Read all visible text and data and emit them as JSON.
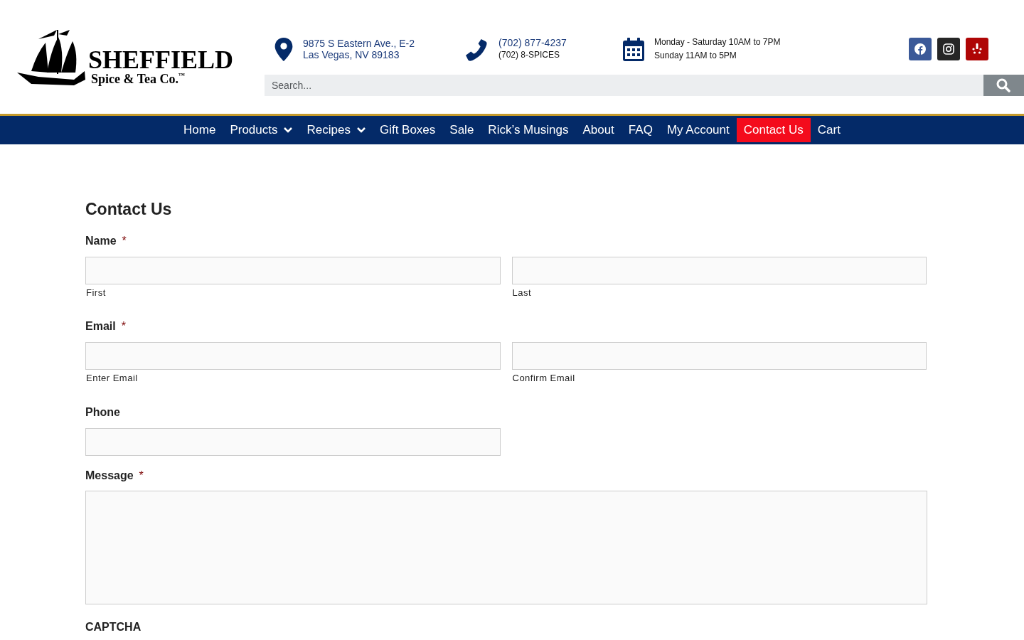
{
  "logo": {
    "name": "SHEFFIELD",
    "tagline": "Spice & Tea Co.",
    "mark": "™"
  },
  "contact": {
    "address": [
      "9875 S Eastern Ave., E-2",
      "Las Vegas, NV 89183"
    ],
    "phones": [
      "(702) 877-4237",
      "(702) 8-SPICES"
    ],
    "hours": [
      "Monday - Saturday 10AM to 7PM",
      "Sunday 11AM to 5PM"
    ]
  },
  "social": [
    {
      "kind": "facebook",
      "color": "#3b5998"
    },
    {
      "kind": "instagram",
      "color": "#262626"
    },
    {
      "kind": "yelp",
      "color": "#af0606"
    }
  ],
  "search": {
    "placeholder": "Search..."
  },
  "nav": [
    {
      "label": "Home",
      "dropdown": false,
      "selected": false
    },
    {
      "label": "Products",
      "dropdown": true,
      "selected": false
    },
    {
      "label": "Recipes",
      "dropdown": true,
      "selected": false
    },
    {
      "label": "Gift Boxes",
      "dropdown": false,
      "selected": false
    },
    {
      "label": "Sale",
      "dropdown": false,
      "selected": false
    },
    {
      "label": "Rick’s Musings",
      "dropdown": false,
      "selected": false
    },
    {
      "label": "About",
      "dropdown": false,
      "selected": false
    },
    {
      "label": "FAQ",
      "dropdown": false,
      "selected": false
    },
    {
      "label": "My Account",
      "dropdown": false,
      "selected": false
    },
    {
      "label": "Contact Us",
      "dropdown": false,
      "selected": true
    },
    {
      "label": "Cart",
      "dropdown": false,
      "selected": false
    }
  ],
  "form": {
    "title": "Contact Us",
    "fields": [
      {
        "kind": "pair",
        "label": "Name",
        "required": true,
        "inputs": [
          {
            "sublabel": "First"
          },
          {
            "sublabel": "Last"
          }
        ]
      },
      {
        "kind": "pair",
        "label": "Email",
        "required": true,
        "inputs": [
          {
            "sublabel": "Enter Email"
          },
          {
            "sublabel": "Confirm Email"
          }
        ]
      },
      {
        "kind": "single",
        "label": "Phone",
        "required": false
      },
      {
        "kind": "textarea",
        "label": "Message",
        "required": true
      },
      {
        "kind": "heading",
        "label": "CAPTCHA",
        "required": false
      }
    ],
    "required_mark": "*"
  }
}
